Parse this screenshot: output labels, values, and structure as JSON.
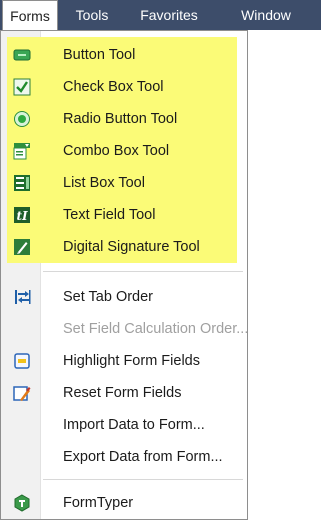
{
  "menubar": {
    "items": [
      {
        "label": "Forms",
        "active": true
      },
      {
        "label": "Tools",
        "active": false
      },
      {
        "label": "Favorites",
        "active": false
      },
      {
        "label": "Window",
        "active": false
      }
    ]
  },
  "dropdown": {
    "highlight_color": "#fbfb77",
    "groups": [
      {
        "highlighted": true,
        "items": [
          {
            "label": "Button Tool",
            "icon": "button-tool-icon",
            "enabled": true
          },
          {
            "label": "Check Box Tool",
            "icon": "check-box-tool-icon",
            "enabled": true
          },
          {
            "label": "Radio Button Tool",
            "icon": "radio-button-tool-icon",
            "enabled": true
          },
          {
            "label": "Combo Box Tool",
            "icon": "combo-box-tool-icon",
            "enabled": true
          },
          {
            "label": "List Box Tool",
            "icon": "list-box-tool-icon",
            "enabled": true
          },
          {
            "label": "Text Field Tool",
            "icon": "text-field-tool-icon",
            "enabled": true
          },
          {
            "label": "Digital Signature Tool",
            "icon": "digital-signature-tool-icon",
            "enabled": true
          }
        ]
      },
      {
        "highlighted": false,
        "items": [
          {
            "label": "Set Tab Order",
            "icon": "tab-order-icon",
            "enabled": true
          },
          {
            "label": "Set Field Calculation Order...",
            "icon": "",
            "enabled": false
          },
          {
            "label": "Highlight Form Fields",
            "icon": "highlight-fields-icon",
            "enabled": true
          },
          {
            "label": "Reset Form Fields",
            "icon": "reset-fields-icon",
            "enabled": true
          },
          {
            "label": "Import Data to Form...",
            "icon": "",
            "enabled": true
          },
          {
            "label": "Export Data from Form...",
            "icon": "",
            "enabled": true
          }
        ]
      },
      {
        "highlighted": false,
        "items": [
          {
            "label": "FormTyper",
            "icon": "formtyper-icon",
            "enabled": true
          }
        ]
      }
    ]
  }
}
